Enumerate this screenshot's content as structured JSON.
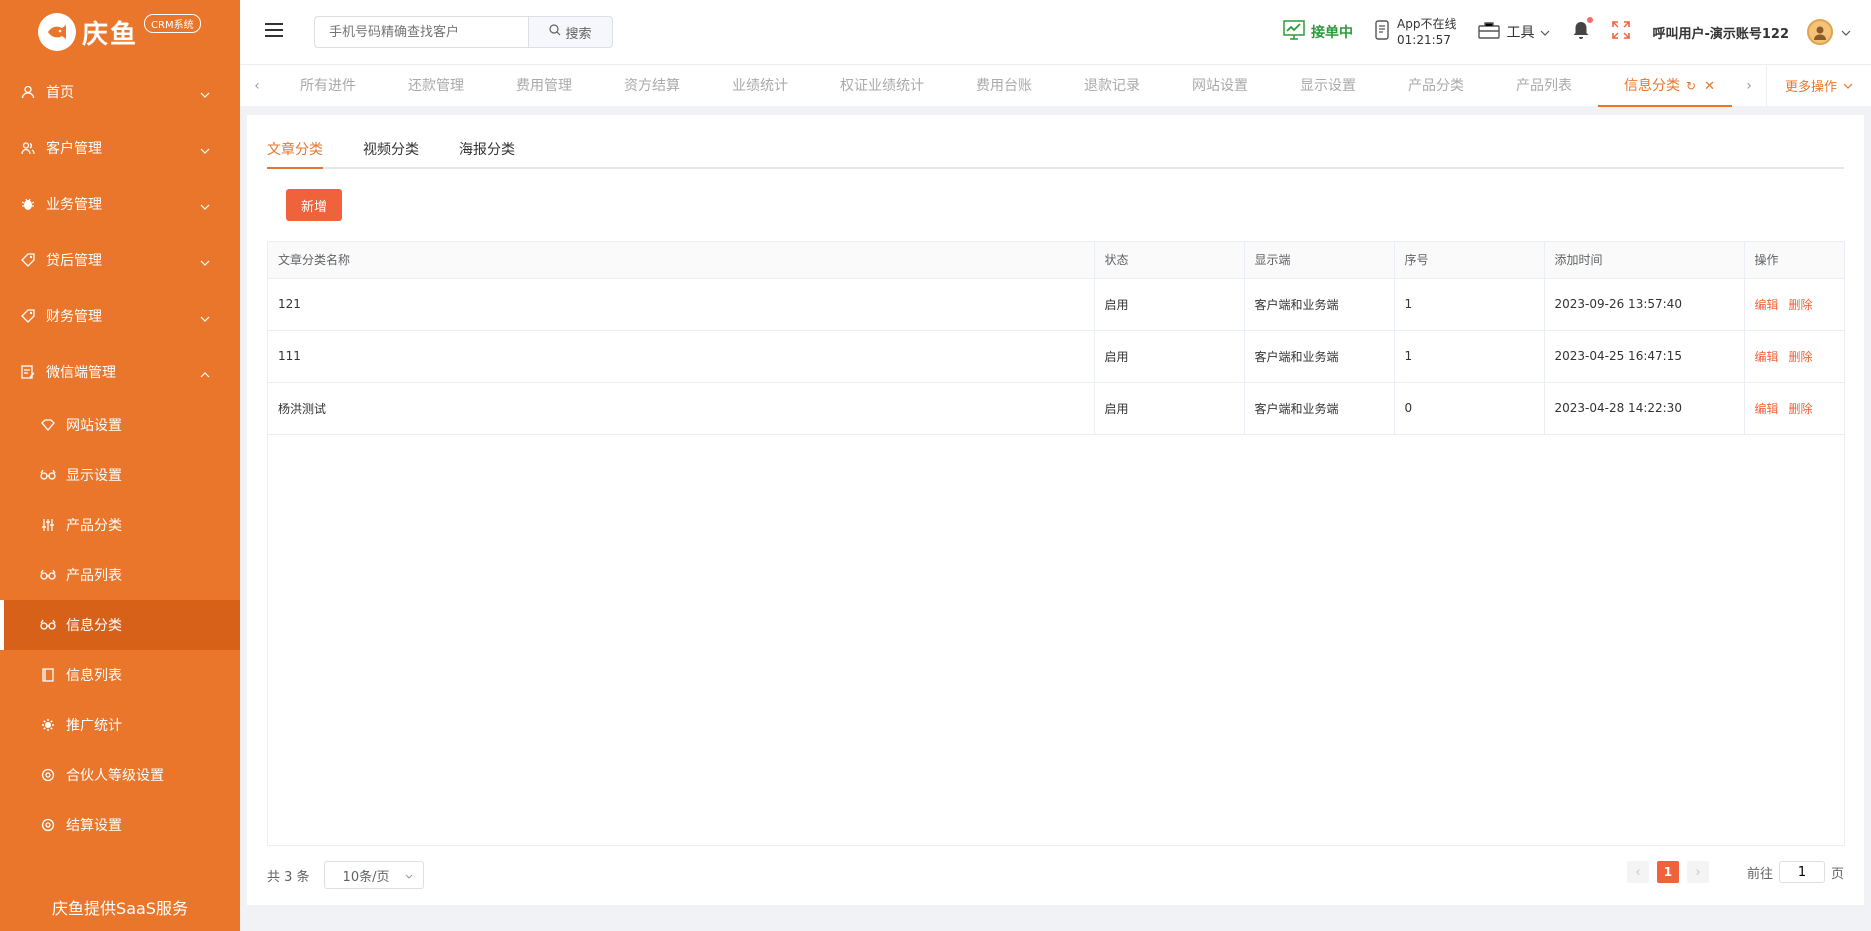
{
  "logo": {
    "text": "庆鱼",
    "badge": "CRM系统"
  },
  "sidebar": {
    "items": [
      {
        "label": "首页",
        "icon": "user-icon"
      },
      {
        "label": "客户管理",
        "icon": "users-icon"
      },
      {
        "label": "业务管理",
        "icon": "bug-icon"
      },
      {
        "label": "贷后管理",
        "icon": "tag-icon"
      },
      {
        "label": "财务管理",
        "icon": "tag-icon"
      },
      {
        "label": "微信端管理",
        "icon": "edit-icon"
      }
    ],
    "sub_items": [
      {
        "label": "网站设置",
        "icon": "diamond-icon"
      },
      {
        "label": "显示设置",
        "icon": "glasses-icon"
      },
      {
        "label": "产品分类",
        "icon": "sliders-icon"
      },
      {
        "label": "产品列表",
        "icon": "glasses-icon"
      },
      {
        "label": "信息分类",
        "icon": "glasses-icon"
      },
      {
        "label": "信息列表",
        "icon": "book-icon"
      },
      {
        "label": "推广统计",
        "icon": "gear-icon"
      },
      {
        "label": "合伙人等级设置",
        "icon": "settings-icon"
      },
      {
        "label": "结算设置",
        "icon": "settings-icon"
      }
    ],
    "footer": "庆鱼提供SaaS服务"
  },
  "topbar": {
    "search_placeholder": "手机号码精确查找客户",
    "search_button": "搜索",
    "status": "接单中",
    "app_status_line1": "App不在线",
    "app_status_line2": "01:21:57",
    "tools": "工具",
    "user_name": "呼叫用户-演示账号122"
  },
  "tabs": {
    "items": [
      "所有进件",
      "还款管理",
      "费用管理",
      "资方结算",
      "业绩统计",
      "权证业绩统计",
      "费用台账",
      "退款记录",
      "网站设置",
      "显示设置",
      "产品分类",
      "产品列表",
      "信息分类"
    ],
    "active_index": 12,
    "more_ops": "更多操作"
  },
  "main": {
    "subtabs": [
      "文章分类",
      "视频分类",
      "海报分类"
    ],
    "add_button": "新增",
    "table": {
      "headers": [
        "文章分类名称",
        "状态",
        "显示端",
        "序号",
        "添加时间",
        "操作"
      ],
      "rows": [
        {
          "name": "121",
          "status": "启用",
          "display": "客户端和业务端",
          "order": "1",
          "time": "2023-09-26 13:57:40"
        },
        {
          "name": "111",
          "status": "启用",
          "display": "客户端和业务端",
          "order": "1",
          "time": "2023-04-25 16:47:15"
        },
        {
          "name": "杨洪测试",
          "status": "启用",
          "display": "客户端和业务端",
          "order": "0",
          "time": "2023-04-28 14:22:30"
        }
      ],
      "edit_label": "编辑",
      "delete_label": "删除"
    },
    "pager": {
      "total": "共 3 条",
      "page_size": "10条/页",
      "current_page": "1",
      "goto_label": "前往",
      "goto_value": "1",
      "page_suffix": "页"
    }
  },
  "colors": {
    "brand": "#e9762b",
    "accent": "#f0623c",
    "online": "#2e9a3c"
  }
}
